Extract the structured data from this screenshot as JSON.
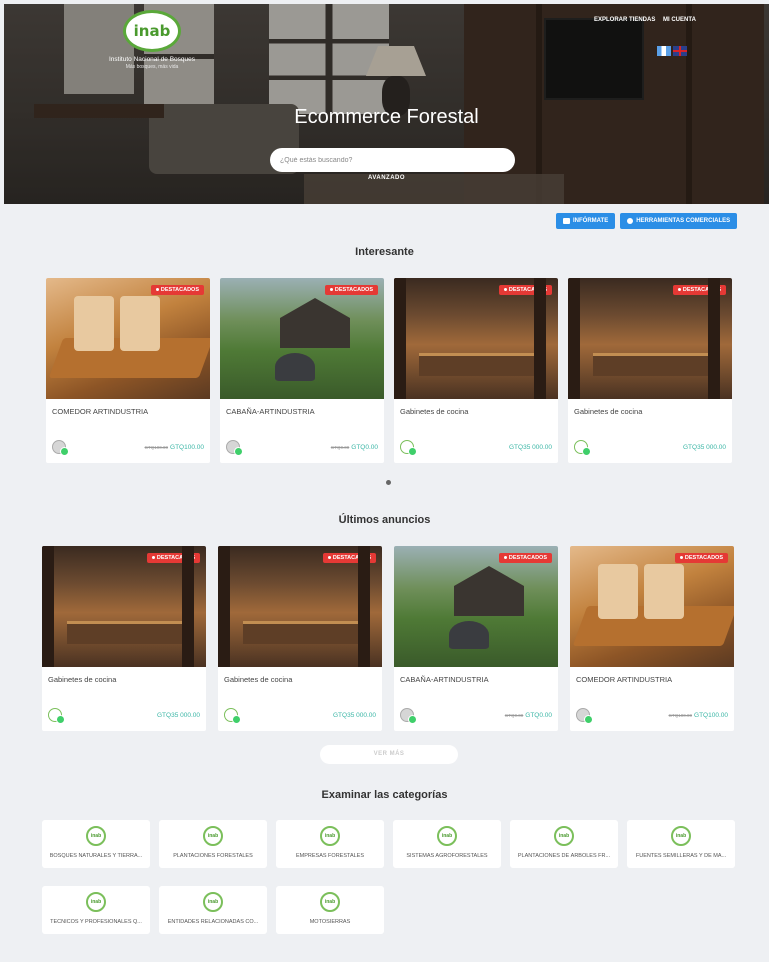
{
  "header": {
    "logo_text": "inab",
    "org_name": "Instituto Nacional de Bosques",
    "org_tagline": "Más bosques, más vida",
    "nav": [
      "EXPLORAR TIENDAS",
      "MI CUENTA"
    ],
    "languages": [
      "Guatemala flag",
      "UK flag"
    ],
    "title": "Ecommerce Forestal",
    "search_placeholder": "¿Qué estás buscando?",
    "advanced_label": "AVANZADO"
  },
  "actions": {
    "informate": "INFÓRMATE",
    "herramientas": "HERRAMIENTAS COMERCIALES"
  },
  "featured": {
    "title": "Interesante",
    "items": [
      {
        "title": "COMEDOR ARTINDUSTRIA",
        "old_price": "GTQ100.00",
        "price": "GTQ100.00",
        "badge": "DESTACADOS",
        "image": "dining"
      },
      {
        "title": "CABAÑA-ARTINDUSTRIA",
        "old_price": "GTQ0.00",
        "price": "GTQ0.00",
        "badge": "DESTACADOS",
        "image": "cabin"
      },
      {
        "title": "Gabinetes de cocina",
        "old_price": "",
        "price": "GTQ35 000.00",
        "badge": "DESTACADOS",
        "image": "kitchen"
      },
      {
        "title": "Gabinetes de cocina",
        "old_price": "",
        "price": "GTQ35 000.00",
        "badge": "DESTACADOS",
        "image": "kitchen"
      }
    ]
  },
  "latest": {
    "title": "Últimos anuncios",
    "items": [
      {
        "title": "Gabinetes de cocina",
        "old_price": "",
        "price": "GTQ35 000.00",
        "badge": "DESTACADOS",
        "image": "kitchen"
      },
      {
        "title": "Gabinetes de cocina",
        "old_price": "",
        "price": "GTQ35 000.00",
        "badge": "DESTACADOS",
        "image": "kitchen"
      },
      {
        "title": "CABAÑA-ARTINDUSTRIA",
        "old_price": "GTQ0.00",
        "price": "GTQ0.00",
        "badge": "DESTACADOS",
        "image": "cabin"
      },
      {
        "title": "COMEDOR ARTINDUSTRIA",
        "old_price": "GTQ100.00",
        "price": "GTQ100.00",
        "badge": "DESTACADOS",
        "image": "dining"
      }
    ],
    "more_label": "VER MÁS"
  },
  "categories": {
    "title": "Examinar las categorías",
    "items": [
      "BOSQUES NATURALES Y TIERRA...",
      "PLANTACIONES FORESTALES",
      "EMPRESAS FORESTALES",
      "SISTEMAS AGROFORESTALES",
      "PLANTACIONES DE ÁRBOLES FR...",
      "FUENTES SEMILLERAS Y DE MA...",
      "TÉCNICOS Y PROFESIONALES Q...",
      "ENTIDADES RELACIONADAS CO...",
      "MOTOSIERRAS"
    ]
  },
  "colors": {
    "primary_button": "#2b8ee6",
    "badge": "#e53935",
    "price": "#3bb6a6",
    "online": "#3fcf6a",
    "brand_green": "#5aa83a"
  }
}
